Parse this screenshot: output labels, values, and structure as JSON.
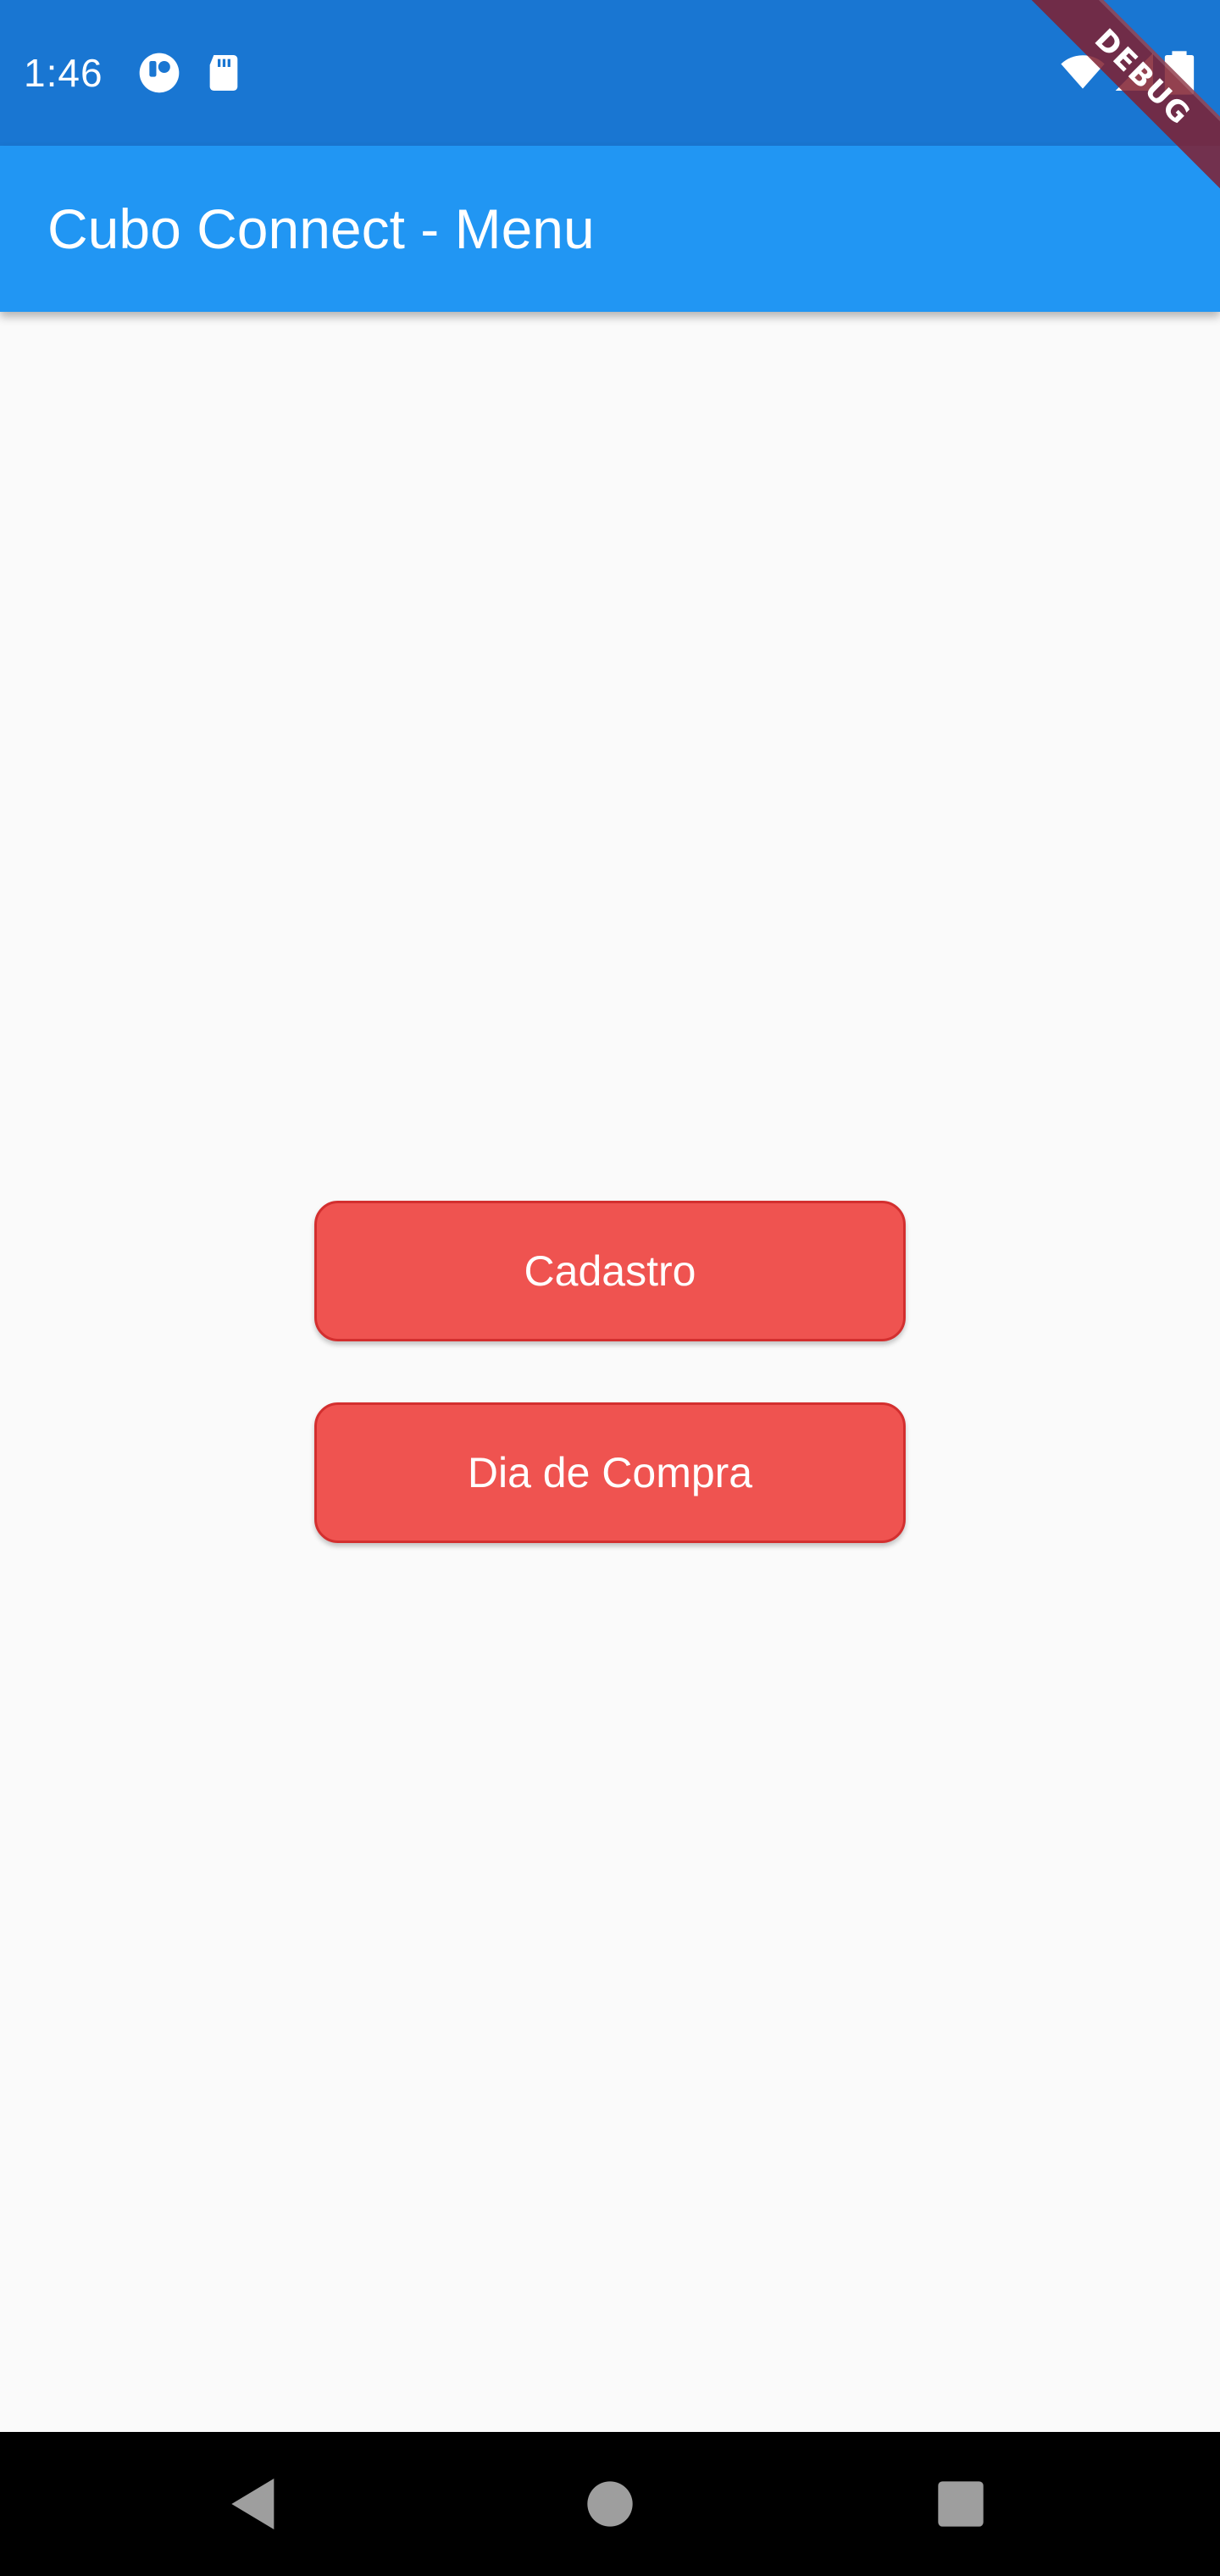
{
  "status_bar": {
    "time": "1:46",
    "icons": [
      "app-notification-icon",
      "sd-card-icon",
      "wifi-icon",
      "cell-signal-icon",
      "battery-icon"
    ],
    "background": "#1976d2"
  },
  "app_bar": {
    "title": "Cubo Connect - Menu",
    "background": "#2196f3"
  },
  "debug_banner": {
    "label": "DEBUG"
  },
  "menu": {
    "buttons": [
      {
        "label": "Cadastro"
      },
      {
        "label": "Dia de Compra"
      }
    ],
    "button_color": "#ef5350",
    "button_border": "#d32f2f"
  },
  "nav_bar": {
    "buttons": [
      "back-icon",
      "home-icon",
      "recents-icon"
    ]
  }
}
